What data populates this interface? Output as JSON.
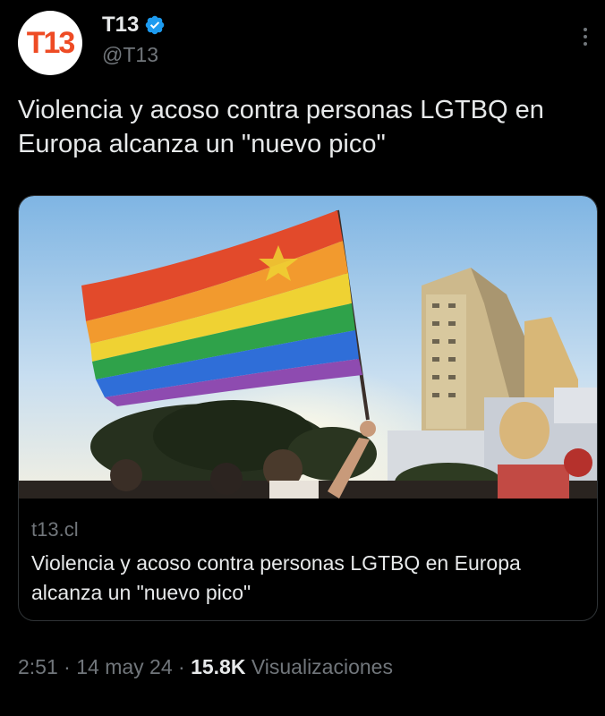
{
  "author": {
    "avatar_text": "T13",
    "display_name": "T13",
    "handle": "@T13",
    "verified_icon": "verified-badge-icon",
    "verified_color": "#1d9bf0"
  },
  "tweet": {
    "text": "Violencia y acoso contra personas LGTBQ en Europa alcanza un \"nuevo pico\""
  },
  "card": {
    "domain": "t13.cl",
    "title": "Violencia y acoso contra personas LGTBQ en Europa alcanza un \"nuevo pico\""
  },
  "meta": {
    "time": "2:51",
    "separator": "·",
    "date": "14 may 24",
    "views_count": "15.8K",
    "views_label": "Visualizaciones"
  },
  "colors": {
    "background": "#000000",
    "text": "#e7e9ea",
    "secondary": "#71767b",
    "brand": "#ee4b24"
  }
}
